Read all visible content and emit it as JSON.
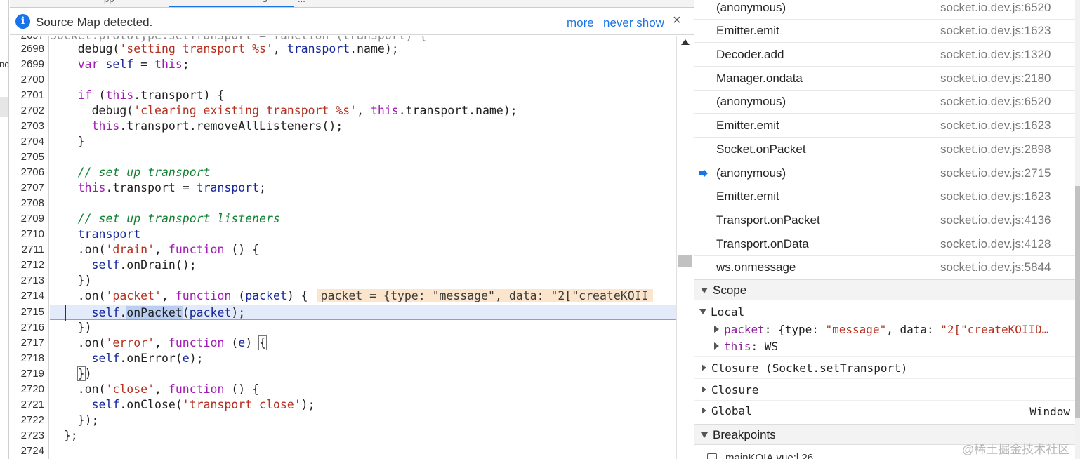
{
  "left_strip": {
    "partial_label": "nc"
  },
  "top_tabs": {
    "tab1": "pp",
    "tab2": "s",
    "tab3": "..."
  },
  "source_map_bar": {
    "message": "Source Map detected.",
    "more_link": "more",
    "never_show_link": "never show",
    "close_glyph": "×"
  },
  "editor": {
    "partial_top_line": "Socket.prototype.setTransport = function (transport) {",
    "line_numbers": [
      "2698",
      "2699",
      "2700",
      "2701",
      "2702",
      "2703",
      "2704",
      "2705",
      "2706",
      "2707",
      "2708",
      "2709",
      "2710",
      "2711",
      "2712",
      "2713",
      "2714",
      "2715",
      "2716",
      "2717",
      "2718",
      "2719",
      "2720",
      "2721",
      "2722",
      "2723",
      "2724"
    ],
    "partial_top_number": "2697",
    "current_line": "2715",
    "inline_value": "packet = {type: \"message\", data: \"2[\"createKOII"
  },
  "call_stack": {
    "frames": [
      {
        "fn": "(anonymous)",
        "loc": "socket.io.dev.js:6520",
        "current": false
      },
      {
        "fn": "Emitter.emit",
        "loc": "socket.io.dev.js:1623",
        "current": false
      },
      {
        "fn": "Decoder.add",
        "loc": "socket.io.dev.js:1320",
        "current": false
      },
      {
        "fn": "Manager.ondata",
        "loc": "socket.io.dev.js:2180",
        "current": false
      },
      {
        "fn": "(anonymous)",
        "loc": "socket.io.dev.js:6520",
        "current": false
      },
      {
        "fn": "Emitter.emit",
        "loc": "socket.io.dev.js:1623",
        "current": false
      },
      {
        "fn": "Socket.onPacket",
        "loc": "socket.io.dev.js:2898",
        "current": false
      },
      {
        "fn": "(anonymous)",
        "loc": "socket.io.dev.js:2715",
        "current": true
      },
      {
        "fn": "Emitter.emit",
        "loc": "socket.io.dev.js:1623",
        "current": false
      },
      {
        "fn": "Transport.onPacket",
        "loc": "socket.io.dev.js:4136",
        "current": false
      },
      {
        "fn": "Transport.onData",
        "loc": "socket.io.dev.js:4128",
        "current": false
      },
      {
        "fn": "ws.onmessage",
        "loc": "socket.io.dev.js:5844",
        "current": false
      }
    ]
  },
  "scope": {
    "title": "Scope",
    "local_label": "Local",
    "packet_key": "packet",
    "packet_val_prefix": "{type: ",
    "packet_type": "\"message\"",
    "packet_mid": ", data: ",
    "packet_data": "\"2[\"createKOIID…",
    "this_key": "this",
    "this_val": "WS",
    "closure1": "Closure (Socket.setTransport)",
    "closure2": "Closure",
    "global": "Global",
    "global_val": "Window"
  },
  "breakpoints": {
    "title": "Breakpoints",
    "partial_item": "mainKOIA.vue:l 26"
  },
  "watermark": "@稀土掘金技术社区",
  "colors": {
    "accent": "#1a73e8",
    "current_line_bg": "#e3ebfb",
    "inline_value_bg": "#fbe5cc"
  }
}
